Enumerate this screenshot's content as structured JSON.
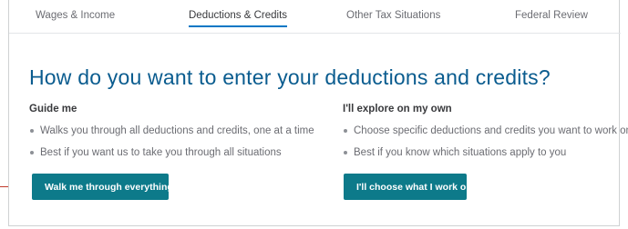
{
  "tabs": [
    {
      "label": "Wages & Income",
      "active": false
    },
    {
      "label": "Deductions & Credits",
      "active": true
    },
    {
      "label": "Other Tax Situations",
      "active": false
    },
    {
      "label": "Federal Review",
      "active": false
    }
  ],
  "heading": "How do you want to enter your deductions and credits?",
  "guide": {
    "title": "Guide me",
    "bullets": [
      "Walks you through all deductions and credits, one at a time",
      "Best if you want us to take you through all situations"
    ],
    "button_label": "Walk me through everything"
  },
  "explore": {
    "title": "I'll explore on my own",
    "bullets": [
      "Choose specific deductions and credits you want to work on",
      "Best if you know which situations apply to you"
    ],
    "button_label": "I'll choose what I work on"
  },
  "colors": {
    "accent": "#0077c5",
    "button": "#0d7a8a",
    "heading": "#0a5c8f"
  }
}
